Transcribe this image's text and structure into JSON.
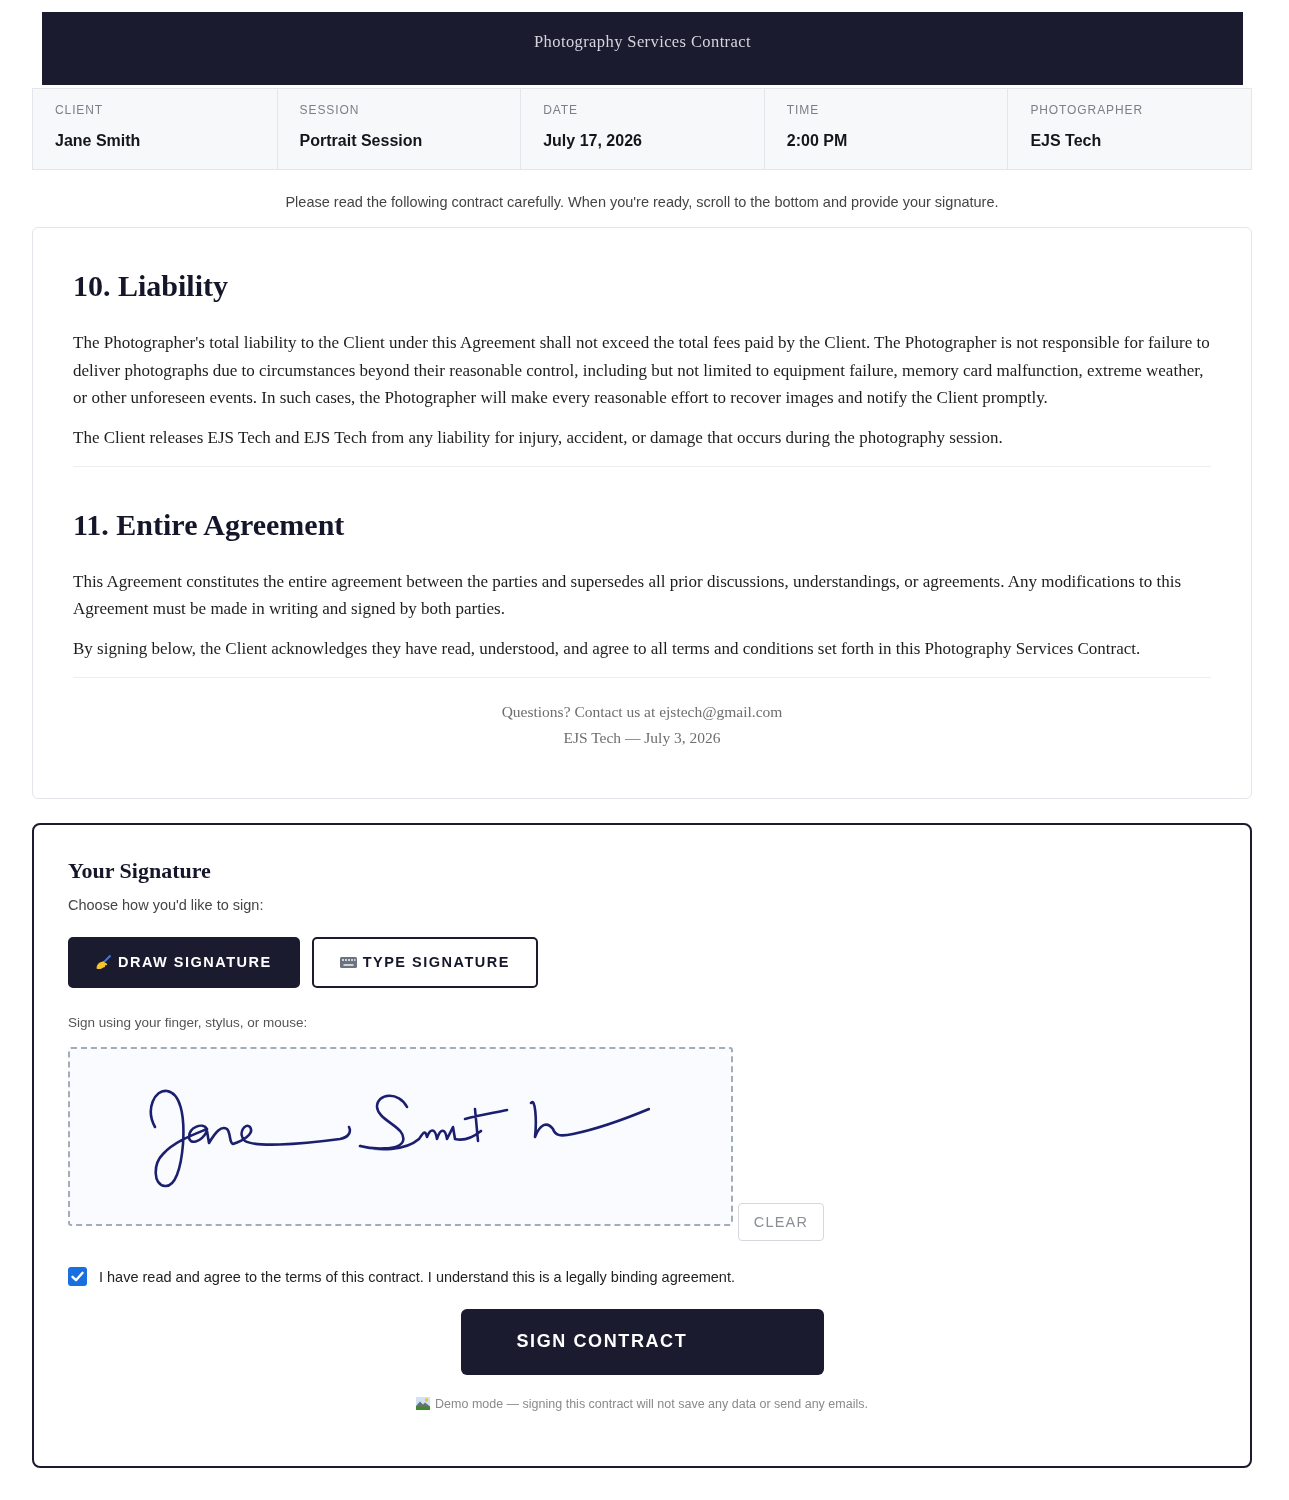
{
  "header": {
    "title": "Photography Services Contract"
  },
  "details": [
    {
      "label": "CLIENT",
      "value": "Jane Smith"
    },
    {
      "label": "SESSION",
      "value": "Portrait Session"
    },
    {
      "label": "DATE",
      "value": "July 17, 2026"
    },
    {
      "label": "TIME",
      "value": "2:00 PM"
    },
    {
      "label": "PHOTOGRAPHER",
      "value": "EJS Tech"
    }
  ],
  "intro": "Please read the following contract carefully. When you're ready, scroll to the bottom and provide your signature.",
  "contract": {
    "sections": [
      {
        "heading": "10. Liability",
        "paragraphs": [
          "The Photographer's total liability to the Client under this Agreement shall not exceed the total fees paid by the Client. The Photographer is not responsible for failure to deliver photographs due to circumstances beyond their reasonable control, including but not limited to equipment failure, memory card malfunction, extreme weather, or other unforeseen events. In such cases, the Photographer will make every reasonable effort to recover images and notify the Client promptly.",
          "The Client releases EJS Tech and EJS Tech from any liability for injury, accident, or damage that occurs during the photography session."
        ]
      },
      {
        "heading": "11. Entire Agreement",
        "paragraphs": [
          "This Agreement constitutes the entire agreement between the parties and supersedes all prior discussions, understandings, or agreements. Any modifications to this Agreement must be made in writing and signed by both parties.",
          "By signing below, the Client acknowledges they have read, understood, and agree to all terms and conditions set forth in this Photography Services Contract."
        ]
      }
    ],
    "footer": {
      "contact": "Questions? Contact us at ejstech@gmail.com",
      "signoff": "EJS Tech — July 3, 2026"
    }
  },
  "signature": {
    "title": "Your Signature",
    "prompt": "Choose how you'd like to sign:",
    "modes": [
      {
        "kind": "draw",
        "label": "DRAW SIGNATURE",
        "selected": true
      },
      {
        "kind": "type",
        "label": "TYPE SIGNATURE",
        "selected": false
      }
    ],
    "pad_hint": "Sign using your finger, stylus, or mouse:",
    "clear_label": "CLEAR",
    "agreement": {
      "label": "I have read and agree to the terms of this contract. I understand this is a legally binding agreement.",
      "checked": true
    },
    "submit_label": "SIGN CONTRACT",
    "demo_note": "Demo mode — signing this contract will not save any data or send any emails."
  }
}
